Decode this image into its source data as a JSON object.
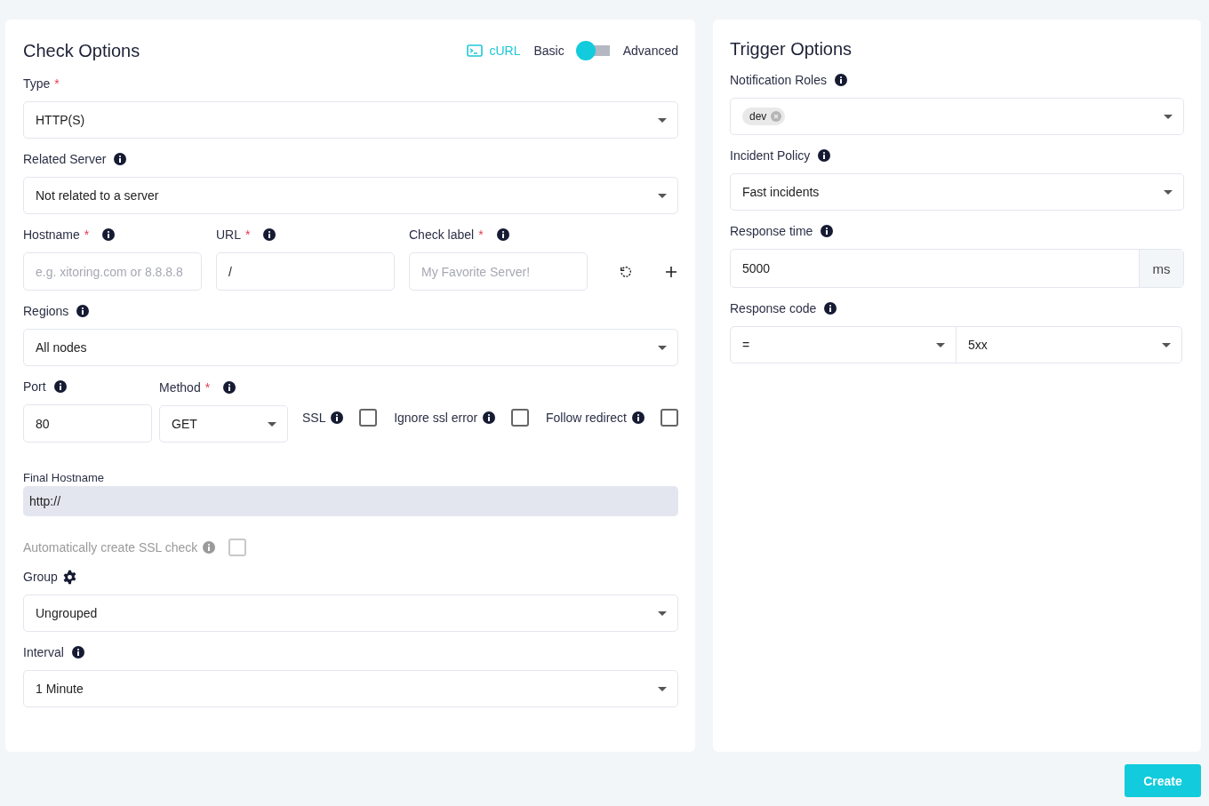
{
  "check_options": {
    "title": "Check Options",
    "curl": "cURL",
    "mode": {
      "basic": "Basic",
      "advanced": "Advanced",
      "advanced_on": false
    },
    "type": {
      "label": "Type",
      "required_mark": "*",
      "value": "HTTP(S)"
    },
    "related_server": {
      "label": "Related Server",
      "info": true,
      "value": "Not related to a server"
    },
    "address": [
      {
        "label": "Hostname",
        "required_mark": "*",
        "info": true,
        "placeholder": "e.g. xitoring.com or 8.8.8.8"
      },
      {
        "label": "URL",
        "required_mark": "*",
        "info": true,
        "value": "/"
      },
      {
        "label": "Check label",
        "required_mark": "*",
        "info": true,
        "placeholder": "My Favorite Server!"
      }
    ],
    "regions": {
      "label": "Regions",
      "info": true,
      "value": "All nodes"
    },
    "port": {
      "label": "Port",
      "info": true,
      "value": "80"
    },
    "method": {
      "label": "Method",
      "required_mark": "*",
      "info": true,
      "value": "GET"
    },
    "options": [
      {
        "label": "SSL",
        "checked": false
      },
      {
        "label": "Ignore ssl error",
        "checked": false
      },
      {
        "label": "Follow redirect",
        "checked": false
      }
    ],
    "final_hostname": {
      "label": "Final Hostname",
      "value": "http://"
    },
    "auto_ssl": {
      "label": "Automatically create SSL check",
      "checked": false,
      "disabled": true
    },
    "group": {
      "label": "Group",
      "value": "Ungrouped"
    },
    "interval": {
      "label": "Interval",
      "info": true,
      "value": "1 Minute"
    }
  },
  "trigger_options": {
    "title": "Trigger Options",
    "notification_roles": {
      "label": "Notification Roles",
      "info": true,
      "tags": [
        "dev"
      ]
    },
    "incident_policy": {
      "label": "Incident Policy",
      "info": true,
      "value": "Fast incidents"
    },
    "response_time": {
      "label": "Response time",
      "info": true,
      "value": "5000",
      "unit": "ms"
    },
    "response_code": {
      "label": "Response code",
      "info": true,
      "operator": "=",
      "value": "5xx"
    }
  },
  "create_button": "Create"
}
